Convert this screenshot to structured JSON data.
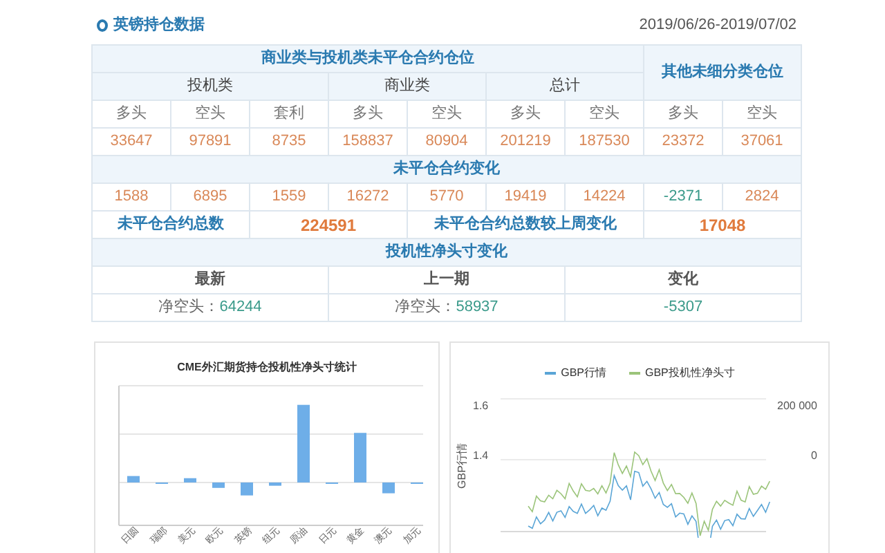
{
  "header": {
    "title": "英镑持仓数据",
    "date_range": "2019/06/26-2019/07/02"
  },
  "table": {
    "group_title": "商业类与投机类未平仓合约仓位",
    "other_title": "其他未细分类仓位",
    "groups": [
      "投机类",
      "商业类",
      "总计"
    ],
    "columns": [
      "多头",
      "空头",
      "套利",
      "多头",
      "空头",
      "多头",
      "空头",
      "多头",
      "空头"
    ],
    "positions": [
      "33647",
      "97891",
      "8735",
      "158837",
      "80904",
      "201219",
      "187530",
      "23372",
      "37061"
    ],
    "change_title": "未平仓合约变化",
    "changes": [
      {
        "text": "1588",
        "color": "#d98858"
      },
      {
        "text": "6895",
        "color": "#d98858"
      },
      {
        "text": "1559",
        "color": "#d98858"
      },
      {
        "text": "16272",
        "color": "#d98858"
      },
      {
        "text": "5770",
        "color": "#d98858"
      },
      {
        "text": "19419",
        "color": "#d98858"
      },
      {
        "text": "14224",
        "color": "#d98858"
      },
      {
        "text": "-2371",
        "color": "#3a9a8a"
      },
      {
        "text": "2824",
        "color": "#d98858"
      }
    ],
    "total_label": "未平仓合约总数",
    "total_value": "224591",
    "weekly_label": "未平仓合约总数较上周变化",
    "weekly_value": "17048",
    "net_title": "投机性净头寸变化",
    "net_columns": [
      "最新",
      "上一期",
      "变化"
    ],
    "net_values": [
      {
        "label": "净空头：",
        "value": "64244"
      },
      {
        "label": "净空头：",
        "value": "58937"
      },
      {
        "value": "-5307"
      }
    ]
  },
  "bar_chart": {
    "title": "CME外汇期货持仓投机性净头寸统计",
    "categories": [
      "日圆",
      "瑞郎",
      "美元",
      "欧元",
      "英镑",
      "纽元",
      "原油",
      "日元",
      "黄金",
      "澳元",
      "加元"
    ]
  },
  "line_chart": {
    "legend": [
      {
        "name": "GBP行情",
        "color": "#5aa5d6"
      },
      {
        "name": "GBP投机性净头寸",
        "color": "#9bc47a"
      }
    ],
    "ylabel": "GBP行情",
    "left_ticks": [
      "1.6",
      "1.4"
    ],
    "right_ticks": [
      "200 000",
      "0"
    ]
  }
}
